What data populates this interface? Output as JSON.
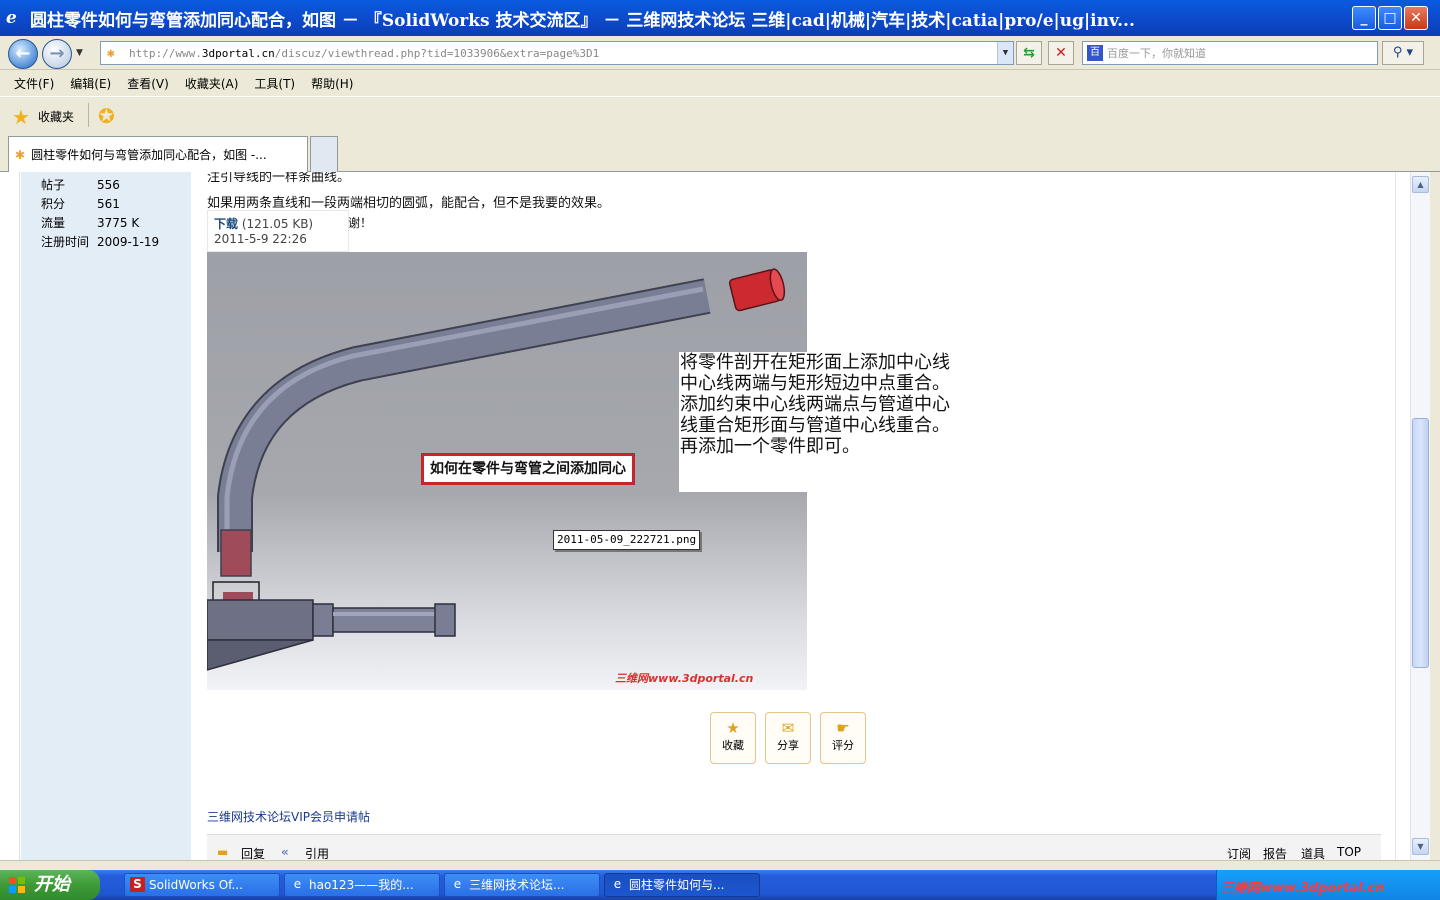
{
  "window": {
    "title": "圆柱零件如何与弯管添加同心配合，如图 － 『SolidWorks 技术交流区』 － 三维网技术论坛 三维|cad|机械|汽车|技术|catia|pro/e|ug|inv..."
  },
  "address": {
    "url_prefix": "http://www.",
    "url_host": "3dportal.cn",
    "url_path": "/discuz/viewthread.php?tid=1033906&extra=page%3D1",
    "search_placeholder": "百度一下，你就知道"
  },
  "menu": [
    "文件(F)",
    "编辑(E)",
    "查看(V)",
    "收藏夹(A)",
    "工具(T)",
    "帮助(H)"
  ],
  "favorites": {
    "label": "收藏夹"
  },
  "tabs": [
    {
      "label": "圆柱零件如何与弯管添加同心配合，如图 -..."
    }
  ],
  "user_stats": [
    {
      "key": "帖子",
      "value": "556"
    },
    {
      "key": "积分",
      "value": "561"
    },
    {
      "key": "流量",
      "value": "3775 K"
    },
    {
      "key": "注册时间",
      "value": "2009-1-19"
    }
  ],
  "post": {
    "line1": "注引导线的一样条曲线。",
    "line2": "如果用两条直线和一段两端相切的圆弧，能配合，但不是我要的效果。",
    "line3_tail": "谢！",
    "attachment": {
      "download_label": "下载",
      "size": "(121.05 KB)",
      "date": "2011-5-9 22:26"
    },
    "image": {
      "red_label": "如何在零件与弯管之间添加同心",
      "filename": "2011-05-09_222721.png",
      "watermark": "三维网www.3dportal.cn"
    },
    "callout": "将零件剖开在矩形面上添加中心线中心线两端与矩形短边中点重合。添加约束中心线两端点与管道中心线重合矩形面与管道中心线重合。再添加一个零件即可。",
    "actions": [
      {
        "icon": "star-icon",
        "label": "收藏"
      },
      {
        "icon": "mail-icon",
        "label": "分享"
      },
      {
        "icon": "thumb-icon",
        "label": "评分"
      }
    ],
    "vip_link": "三维网技术论坛VIP会员申请帖",
    "reply_bar": {
      "reply": "回复",
      "quote": "引用",
      "subscribe": "订阅",
      "report": "报告",
      "tools": "道具",
      "top": "TOP"
    }
  },
  "taskbar": {
    "start": "开始",
    "items": [
      {
        "label": "SolidWorks Of...",
        "active": false
      },
      {
        "label": "hao123——我的...",
        "active": false
      },
      {
        "label": "三维网技术论坛...",
        "active": false
      },
      {
        "label": "圆柱零件如何与...",
        "active": true
      }
    ],
    "tray_watermark": "三维网www.3dportal.cn"
  }
}
